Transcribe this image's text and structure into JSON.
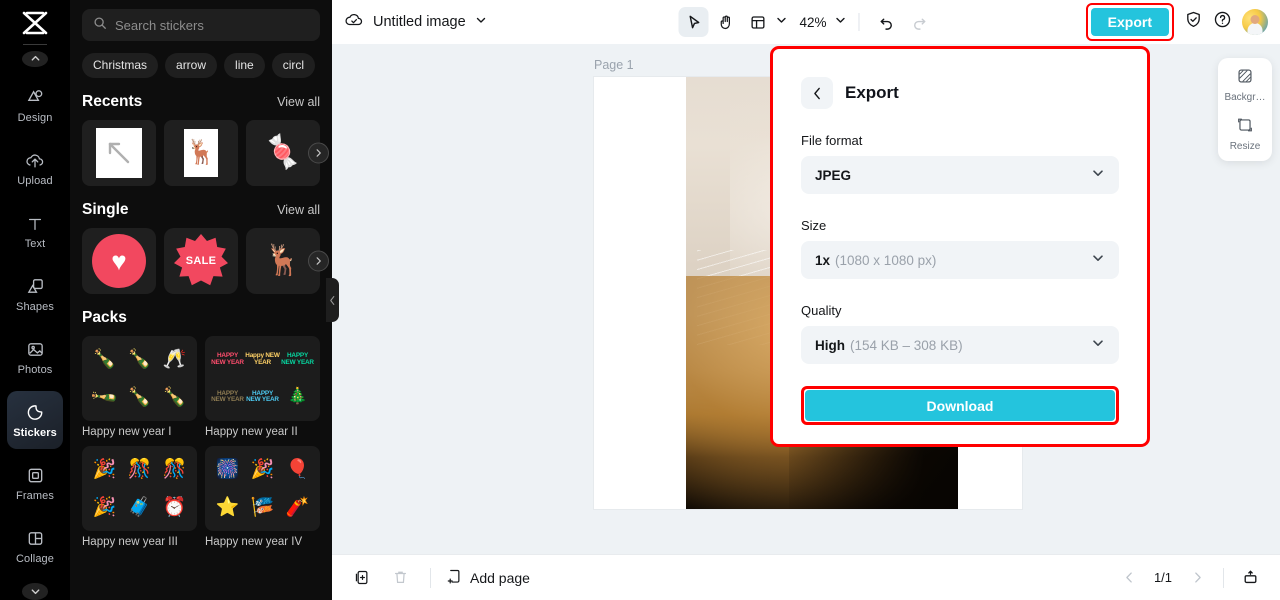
{
  "app": {
    "logo": "capcut-logo",
    "accent_cyan": "#24c4dd",
    "highlight_red": "#ff0000",
    "panel_bg": "#0d0d0d",
    "canvas_bg": "#eef2f5"
  },
  "rail": {
    "collapse_up_icon": "chevron-up-icon",
    "collapse_down_icon": "chevron-down-icon",
    "items": [
      {
        "label": "Design",
        "icon": "design-icon",
        "active": false
      },
      {
        "label": "Upload",
        "icon": "upload-cloud-icon",
        "active": false
      },
      {
        "label": "Text",
        "icon": "text-icon",
        "active": false
      },
      {
        "label": "Shapes",
        "icon": "shapes-icon",
        "active": false
      },
      {
        "label": "Photos",
        "icon": "photos-icon",
        "active": false
      },
      {
        "label": "Stickers",
        "icon": "stickers-icon",
        "active": true
      },
      {
        "label": "Frames",
        "icon": "frames-icon",
        "active": false
      },
      {
        "label": "Collage",
        "icon": "collage-icon",
        "active": false
      }
    ]
  },
  "panel": {
    "search": {
      "placeholder": "Search stickers",
      "value": "",
      "icon": "search-icon"
    },
    "tags": [
      "Christmas",
      "arrow",
      "line",
      "circl"
    ],
    "sections": [
      {
        "title": "Recents",
        "view_all": "View all"
      },
      {
        "title": "Single",
        "view_all": "View all"
      },
      {
        "title": "Packs",
        "view_all": ""
      }
    ],
    "recents": [
      {
        "name": "arrow-up-left-sticker",
        "glyph": "↖"
      },
      {
        "name": "reindeer-sticker",
        "glyph": "🦌"
      },
      {
        "name": "candy-cane-sticker",
        "glyph": "🍬"
      }
    ],
    "single": [
      {
        "name": "heart-sticker",
        "glyph": "♥"
      },
      {
        "name": "sale-badge-sticker",
        "glyph": "SALE"
      },
      {
        "name": "reindeer-sticker",
        "glyph": "🦌"
      }
    ],
    "packs": [
      {
        "name": "Happy new year I",
        "items": [
          "🍾",
          "🍾",
          "🥂",
          "🍾",
          "🍾",
          "🍾"
        ]
      },
      {
        "name": "Happy new year II",
        "items": [
          "HAPPY NEW YEAR",
          "Happy NEW YEAR",
          "HAPPY NEW YEAR",
          "HAPPY NEW YEAR",
          "HAPPY NEW YEAR",
          "🎄"
        ]
      },
      {
        "name": "Happy new year III",
        "items": [
          "🎉",
          "🎊",
          "🎊",
          "🎉",
          "🧳",
          "⏰"
        ]
      },
      {
        "name": "Happy new year IV",
        "items": [
          "🎆",
          "🎉",
          "🎈",
          "⭐",
          "🎏",
          "🧨"
        ]
      }
    ],
    "next_arrow_icon": "chevron-right-icon",
    "collapse_handle_icon": "chevron-left-icon"
  },
  "topbar": {
    "cloud_icon": "cloud-saved-icon",
    "doc_title": "Untitled image",
    "doc_title_chevron": "chevron-down-icon",
    "tools": [
      {
        "name": "select-tool",
        "icon": "cursor-arrow-icon",
        "selected": true
      },
      {
        "name": "hand-tool",
        "icon": "hand-icon",
        "selected": false
      },
      {
        "name": "layout-tool",
        "icon": "layout-panel-icon",
        "selected": false
      }
    ],
    "layout_chevron": "chevron-down-icon",
    "zoom_level": "42%",
    "zoom_chevron": "chevron-down-icon",
    "undo_icon": "undo-icon",
    "redo_icon": "redo-icon",
    "export_label": "Export",
    "shield_icon": "shield-check-icon",
    "help_icon": "help-circle-icon",
    "avatar": "user-avatar"
  },
  "canvas": {
    "page_label": "Page 1",
    "artwork": "cat-photo"
  },
  "right_tools": [
    {
      "label": "Backgr…",
      "icon": "background-icon"
    },
    {
      "label": "Resize",
      "icon": "resize-icon"
    }
  ],
  "export_panel": {
    "back_icon": "chevron-left-icon",
    "title": "Export",
    "fields": [
      {
        "label": "File format",
        "value": "JPEG",
        "hint": "",
        "chevron": "chevron-down-icon"
      },
      {
        "label": "Size",
        "value": "1x",
        "hint": "(1080 x 1080 px)",
        "chevron": "chevron-down-icon"
      },
      {
        "label": "Quality",
        "value": "High",
        "hint": "(154 KB – 308 KB)",
        "chevron": "chevron-down-icon"
      }
    ],
    "download_label": "Download"
  },
  "bottombar": {
    "duplicate_icon": "duplicate-page-icon",
    "delete_icon": "trash-icon",
    "add_page_icon": "add-page-icon",
    "add_page_label": "Add page",
    "prev_icon": "chevron-left-icon",
    "page_indicator": "1/1",
    "next_icon": "chevron-right-icon",
    "grid_view_icon": "page-grid-icon"
  }
}
